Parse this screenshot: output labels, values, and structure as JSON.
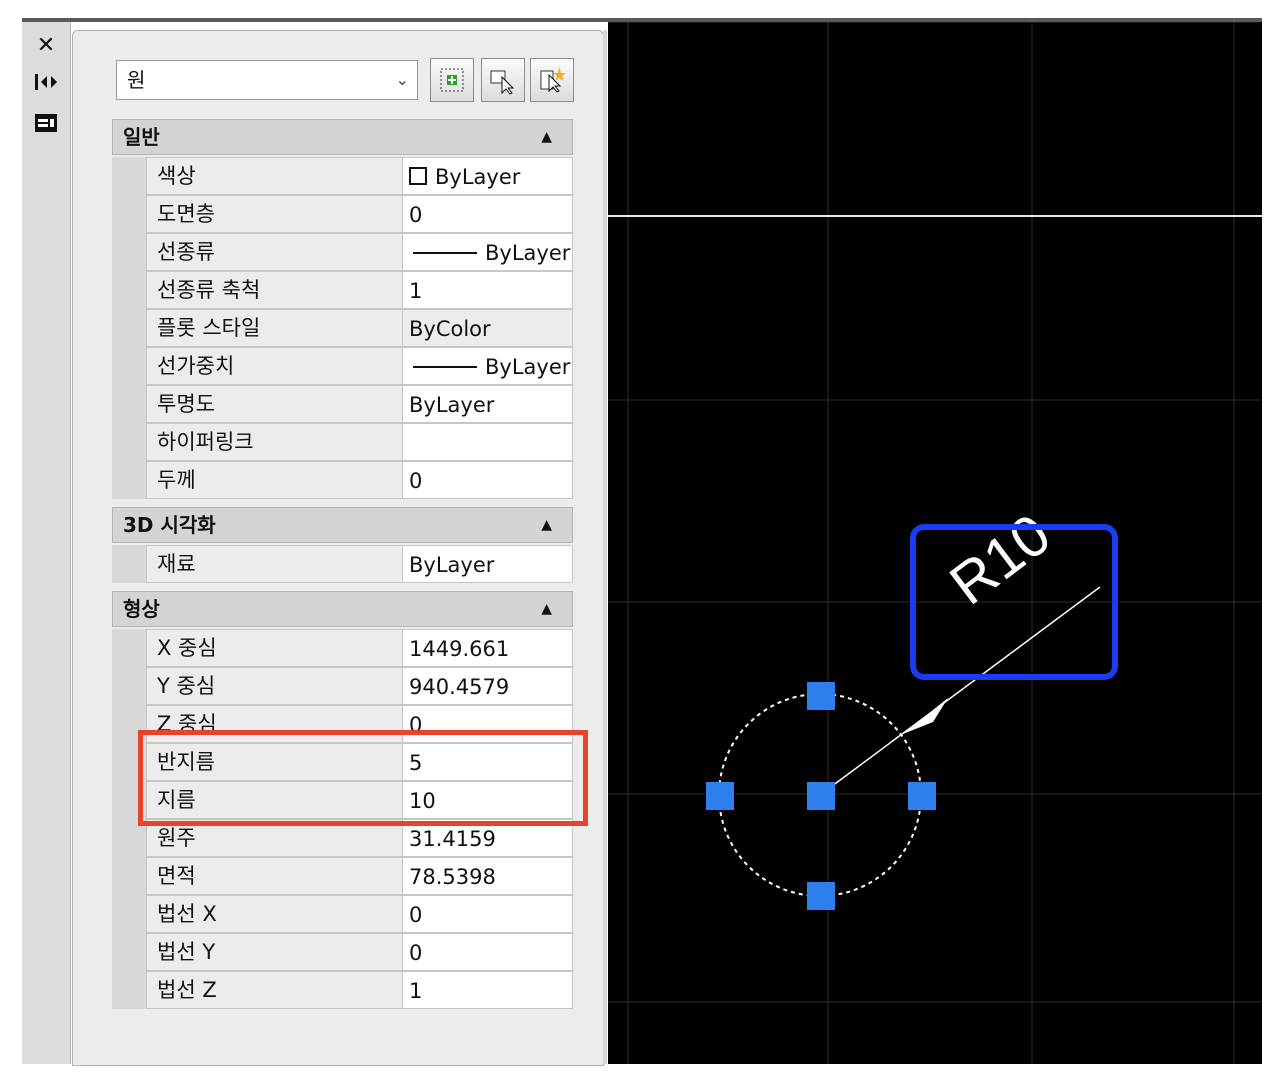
{
  "left_toolbar": {
    "icons": [
      "close-icon",
      "auto-hide-icon",
      "properties-menu-icon"
    ]
  },
  "selector": {
    "value": "원",
    "buttons": [
      "toggle-pickadd-icon",
      "select-objects-icon",
      "quick-select-icon"
    ]
  },
  "sections": {
    "general": {
      "title": "일반",
      "rows": [
        {
          "name": "색상",
          "value": "ByLayer"
        },
        {
          "name": "도면층",
          "value": "0"
        },
        {
          "name": "선종류",
          "value": "ByLayer"
        },
        {
          "name": "선종류 축척",
          "value": "1"
        },
        {
          "name": "플롯 스타일",
          "value": "ByColor"
        },
        {
          "name": "선가중치",
          "value": "ByLayer"
        },
        {
          "name": "투명도",
          "value": "ByLayer"
        },
        {
          "name": "하이퍼링크",
          "value": ""
        },
        {
          "name": "두께",
          "value": "0"
        }
      ]
    },
    "visualization": {
      "title": "3D 시각화",
      "rows": [
        {
          "name": "재료",
          "value": "ByLayer"
        }
      ]
    },
    "geometry": {
      "title": "형상",
      "rows": [
        {
          "name": "X 중심",
          "value": "1449.661"
        },
        {
          "name": "Y 중심",
          "value": "940.4579"
        },
        {
          "name": "Z 중심",
          "value": "0"
        },
        {
          "name": "반지름",
          "value": "5"
        },
        {
          "name": "지름",
          "value": "10"
        },
        {
          "name": "원주",
          "value": "31.4159"
        },
        {
          "name": "면적",
          "value": "78.5398"
        },
        {
          "name": "법선 X",
          "value": "0"
        },
        {
          "name": "법선 Y",
          "value": "0"
        },
        {
          "name": "법선 Z",
          "value": "1"
        }
      ]
    }
  },
  "drawing": {
    "dimension_text": "R10",
    "grip_color": "#2f7fef",
    "highlight_red": "#e8442c",
    "highlight_blue": "#1c3cf0"
  }
}
